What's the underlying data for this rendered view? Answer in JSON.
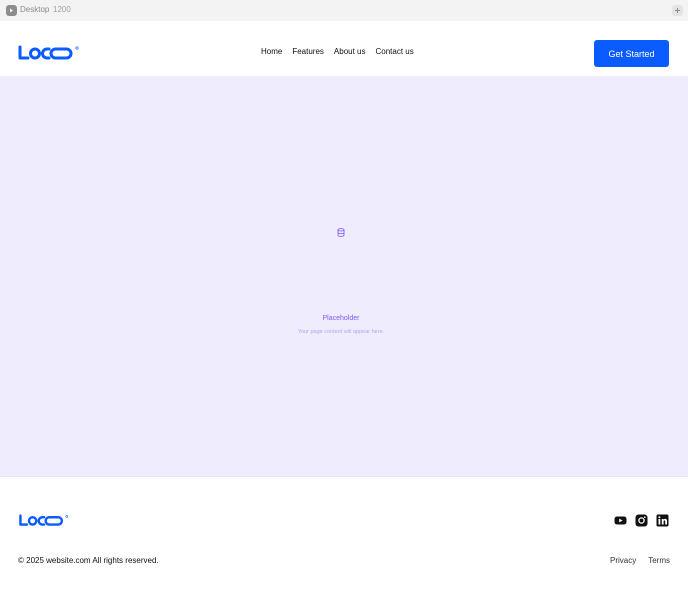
{
  "editor": {
    "frame_name": "Desktop",
    "frame_width": "1200",
    "frame_icon": "frame-icon",
    "add_icon": "plus-icon"
  },
  "header": {
    "logo_icon": "logo-icon",
    "nav": [
      {
        "label": "Home"
      },
      {
        "label": "Features"
      },
      {
        "label": "About us"
      },
      {
        "label": "Contact us"
      }
    ],
    "cta_label": "Get Started"
  },
  "placeholder": {
    "icon": "database-icon",
    "title": "Placeholder",
    "description": "Your page content will appear here."
  },
  "footer": {
    "logo_icon": "logo-icon",
    "socials": [
      {
        "icon": "youtube-icon"
      },
      {
        "icon": "instagram-icon"
      },
      {
        "icon": "linkedin-icon"
      }
    ],
    "copyright": "© 2025 website.com All rights reserved.",
    "links": [
      {
        "label": "Privacy"
      },
      {
        "label": "Terms"
      }
    ]
  },
  "colors": {
    "brand": "#0a5cff",
    "canvas_bg": "#efecfe",
    "placeholder_accent": "#7b5cf0"
  }
}
